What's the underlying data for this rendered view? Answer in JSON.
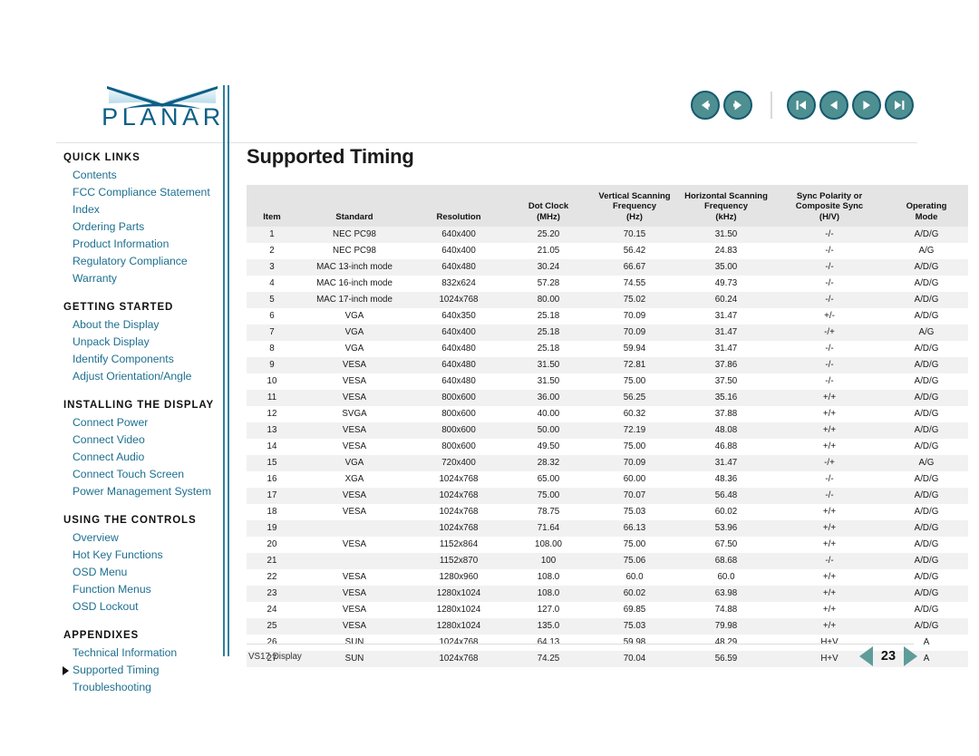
{
  "brand": {
    "name": "PLANAR",
    "logo_icon": "planar-swoosh-logo"
  },
  "toolbar": {
    "buttons": [
      {
        "name": "back-button",
        "icon": "arrow-left-circle-icon",
        "label": "Back"
      },
      {
        "name": "forward-button",
        "icon": "arrow-right-circle-icon",
        "label": "Forward"
      },
      {
        "name": "first-page-button",
        "icon": "skip-to-first-page-icon",
        "label": "First Page"
      },
      {
        "name": "previous-page-button",
        "icon": "previous-page-icon",
        "label": "Previous Page"
      },
      {
        "name": "next-page-button",
        "icon": "next-page-icon",
        "label": "Next Page"
      },
      {
        "name": "last-page-button",
        "icon": "skip-to-last-page-icon",
        "label": "Last Page"
      }
    ]
  },
  "sidebar": {
    "sections": [
      {
        "heading": "QUICK LINKS",
        "links": [
          {
            "label": "Contents",
            "active": false
          },
          {
            "label": "FCC Compliance Statement",
            "active": false
          },
          {
            "label": "Index",
            "active": false
          },
          {
            "label": "Ordering Parts",
            "active": false
          },
          {
            "label": "Product Information",
            "active": false
          },
          {
            "label": "Regulatory Compliance",
            "active": false
          },
          {
            "label": "Warranty",
            "active": false
          }
        ]
      },
      {
        "heading": "GETTING STARTED",
        "links": [
          {
            "label": "About the Display",
            "active": false
          },
          {
            "label": "Unpack Display",
            "active": false
          },
          {
            "label": "Identify Components",
            "active": false
          },
          {
            "label": "Adjust Orientation/Angle",
            "active": false
          }
        ]
      },
      {
        "heading": "INSTALLING THE DISPLAY",
        "links": [
          {
            "label": "Connect Power",
            "active": false
          },
          {
            "label": "Connect Video",
            "active": false
          },
          {
            "label": "Connect Audio",
            "active": false
          },
          {
            "label": "Connect Touch Screen",
            "active": false
          },
          {
            "label": "Power Management System",
            "active": false
          }
        ]
      },
      {
        "heading": "USING THE CONTROLS",
        "links": [
          {
            "label": "Overview",
            "active": false
          },
          {
            "label": "Hot Key Functions",
            "active": false
          },
          {
            "label": "OSD Menu",
            "active": false
          },
          {
            "label": "Function Menus",
            "active": false
          },
          {
            "label": "OSD Lockout",
            "active": false
          }
        ]
      },
      {
        "heading": "APPENDIXES",
        "links": [
          {
            "label": "Technical Information",
            "active": false
          },
          {
            "label": "Supported Timing",
            "active": true
          },
          {
            "label": "Troubleshooting",
            "active": false
          }
        ]
      }
    ]
  },
  "main": {
    "title": "Supported Timing",
    "table": {
      "headers": [
        {
          "lines": [
            "Item"
          ]
        },
        {
          "lines": [
            "Standard"
          ]
        },
        {
          "lines": [
            "Resolution"
          ]
        },
        {
          "lines": [
            "Dot Clock",
            "(MHz)"
          ]
        },
        {
          "lines": [
            "Vertical Scanning",
            "Frequency",
            "(Hz)"
          ]
        },
        {
          "lines": [
            "Horizontal Scanning",
            "Frequency",
            "(kHz)"
          ]
        },
        {
          "lines": [
            "Sync Polarity or",
            "Composite Sync",
            "(H/V)"
          ]
        },
        {
          "lines": [
            "Operating",
            "Mode"
          ]
        }
      ],
      "rows": [
        [
          "1",
          "NEC PC98",
          "640x400",
          "25.20",
          "70.15",
          "31.50",
          "-/-",
          "A/D/G"
        ],
        [
          "2",
          "NEC PC98",
          "640x400",
          "21.05",
          "56.42",
          "24.83",
          "-/-",
          "A/G"
        ],
        [
          "3",
          "MAC 13-inch mode",
          "640x480",
          "30.24",
          "66.67",
          "35.00",
          "-/-",
          "A/D/G"
        ],
        [
          "4",
          "MAC 16-inch mode",
          "832x624",
          "57.28",
          "74.55",
          "49.73",
          "-/-",
          "A/D/G"
        ],
        [
          "5",
          "MAC 17-inch mode",
          "1024x768",
          "80.00",
          "75.02",
          "60.24",
          "-/-",
          "A/D/G"
        ],
        [
          "6",
          "VGA",
          "640x350",
          "25.18",
          "70.09",
          "31.47",
          "+/-",
          "A/D/G"
        ],
        [
          "7",
          "VGA",
          "640x400",
          "25.18",
          "70.09",
          "31.47",
          "-/+",
          "A/G"
        ],
        [
          "8",
          "VGA",
          "640x480",
          "25.18",
          "59.94",
          "31.47",
          "-/-",
          "A/D/G"
        ],
        [
          "9",
          "VESA",
          "640x480",
          "31.50",
          "72.81",
          "37.86",
          "-/-",
          "A/D/G"
        ],
        [
          "10",
          "VESA",
          "640x480",
          "31.50",
          "75.00",
          "37.50",
          "-/-",
          "A/D/G"
        ],
        [
          "11",
          "VESA",
          "800x600",
          "36.00",
          "56.25",
          "35.16",
          "+/+",
          "A/D/G"
        ],
        [
          "12",
          "SVGA",
          "800x600",
          "40.00",
          "60.32",
          "37.88",
          "+/+",
          "A/D/G"
        ],
        [
          "13",
          "VESA",
          "800x600",
          "50.00",
          "72.19",
          "48.08",
          "+/+",
          "A/D/G"
        ],
        [
          "14",
          "VESA",
          "800x600",
          "49.50",
          "75.00",
          "46.88",
          "+/+",
          "A/D/G"
        ],
        [
          "15",
          "VGA",
          "720x400",
          "28.32",
          "70.09",
          "31.47",
          "-/+",
          "A/G"
        ],
        [
          "16",
          "XGA",
          "1024x768",
          "65.00",
          "60.00",
          "48.36",
          "-/-",
          "A/D/G"
        ],
        [
          "17",
          "VESA",
          "1024x768",
          "75.00",
          "70.07",
          "56.48",
          "-/-",
          "A/D/G"
        ],
        [
          "18",
          "VESA",
          "1024x768",
          "78.75",
          "75.03",
          "60.02",
          "+/+",
          "A/D/G"
        ],
        [
          "19",
          "",
          "1024x768",
          "71.64",
          "66.13",
          "53.96",
          "+/+",
          "A/D/G"
        ],
        [
          "20",
          "VESA",
          "1152x864",
          "108.00",
          "75.00",
          "67.50",
          "+/+",
          "A/D/G"
        ],
        [
          "21",
          "",
          "1152x870",
          "100",
          "75.06",
          "68.68",
          "-/-",
          "A/D/G"
        ],
        [
          "22",
          "VESA",
          "1280x960",
          "108.0",
          "60.0",
          "60.0",
          "+/+",
          "A/D/G"
        ],
        [
          "23",
          "VESA",
          "1280x1024",
          "108.0",
          "60.02",
          "63.98",
          "+/+",
          "A/D/G"
        ],
        [
          "24",
          "VESA",
          "1280x1024",
          "127.0",
          "69.85",
          "74.88",
          "+/+",
          "A/D/G"
        ],
        [
          "25",
          "VESA",
          "1280x1024",
          "135.0",
          "75.03",
          "79.98",
          "+/+",
          "A/D/G"
        ],
        [
          "26",
          "SUN",
          "1024x768",
          "64.13",
          "59.98",
          "48.29",
          "H+V",
          "A"
        ],
        [
          "27",
          "SUN",
          "1024x768",
          "74.25",
          "70.04",
          "56.59",
          "H+V",
          "A"
        ]
      ]
    }
  },
  "footer": {
    "document_label": "VS17 Display",
    "page_number": "23",
    "prev_icon": "triangle-left-icon",
    "next_icon": "triangle-right-icon"
  },
  "colors": {
    "link": "#1d6f90",
    "brand": "#0d5f86",
    "nav_button": "#4e8f92",
    "nav_button_border": "#16596f",
    "pager_arrow": "#5e9c9a",
    "table_header_bg": "#e4e4e4",
    "table_stripe": "#f1f1f1"
  }
}
